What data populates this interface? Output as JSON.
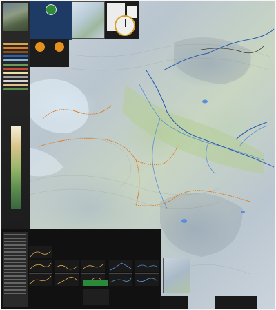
{
  "map": {
    "title_lines": [
      "",
      "",
      "",
      "",
      ""
    ],
    "ethics_left": {
      "heading": ""
    },
    "ethics_right": {
      "heading": ""
    }
  },
  "colors": {
    "trail_orange": "#e07b1f",
    "road_blue": "#2b5fb0",
    "info_dark": "#1c1c1c",
    "header_blue": "#1e3b66",
    "title_yellow": "#f2d64a",
    "badge_orange": "#e4911f",
    "lake_blue": "#5a8ed8",
    "profile_orange": "#e0a64c",
    "profile_blue": "#5a8ed8"
  },
  "icons": [
    "compass-icon",
    "emblem-icon",
    "elevation-gradient-icon"
  ],
  "legend_swatches": [
    "#d8a64a",
    "#e07b1f",
    "#8e4e1a",
    "#2b5fb0",
    "#7fb8e3",
    "#6a9a56",
    "#c24a3a",
    "#f0e0a0",
    "#a3a3a3",
    "#d6d6d6",
    "#e2c08a",
    "#5d8f4e"
  ]
}
